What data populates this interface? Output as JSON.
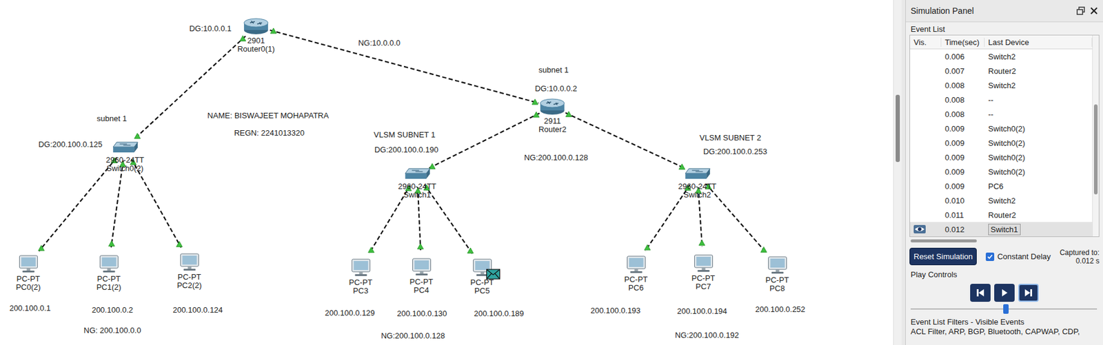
{
  "canvas": {
    "devices": [
      {
        "name": "Router0(1)",
        "model": "2901",
        "kind": "router",
        "packet": false
      },
      {
        "name": "Router2",
        "model": "2911",
        "kind": "router",
        "packet": false
      },
      {
        "name": "Switch0(2)",
        "model": "2960-24TT",
        "kind": "switch",
        "packet": false
      },
      {
        "name": "Switch1",
        "model": "2960-24TT",
        "kind": "switch",
        "packet": false
      },
      {
        "name": "Switch2",
        "model": "2960-24TT",
        "kind": "switch",
        "packet": false
      },
      {
        "name": "PC0(2)",
        "model": "PC-PT",
        "kind": "pc",
        "packet": false
      },
      {
        "name": "PC1(2)",
        "model": "PC-PT",
        "kind": "pc",
        "packet": false
      },
      {
        "name": "PC2(2)",
        "model": "PC-PT",
        "kind": "pc",
        "packet": false
      },
      {
        "name": "PC3",
        "model": "PC-PT",
        "kind": "pc",
        "packet": false
      },
      {
        "name": "PC4",
        "model": "PC-PT",
        "kind": "pc",
        "packet": false
      },
      {
        "name": "PC5",
        "model": "PC-PT",
        "kind": "pc",
        "packet": true
      },
      {
        "name": "PC6",
        "model": "PC-PT",
        "kind": "pc",
        "packet": false
      },
      {
        "name": "PC7",
        "model": "PC-PT",
        "kind": "pc",
        "packet": false
      },
      {
        "name": "PC8",
        "model": "PC-PT",
        "kind": "pc",
        "packet": false
      }
    ],
    "links": [
      {
        "from": "Router0(1)",
        "to": "Switch0(2)"
      },
      {
        "from": "Router0(1)",
        "to": "Router2"
      },
      {
        "from": "Router2",
        "to": "Switch1"
      },
      {
        "from": "Router2",
        "to": "Switch2"
      },
      {
        "from": "Switch0(2)",
        "to": "PC0(2)"
      },
      {
        "from": "Switch0(2)",
        "to": "PC1(2)"
      },
      {
        "from": "Switch0(2)",
        "to": "PC2(2)"
      },
      {
        "from": "Switch1",
        "to": "PC3"
      },
      {
        "from": "Switch1",
        "to": "PC4"
      },
      {
        "from": "Switch1",
        "to": "PC5"
      },
      {
        "from": "Switch2",
        "to": "PC6"
      },
      {
        "from": "Switch2",
        "to": "PC7"
      },
      {
        "from": "Switch2",
        "to": "PC8"
      }
    ],
    "annotations": [
      {
        "text": "DG:10.0.0.1"
      },
      {
        "text": "NG:10.0.0.0"
      },
      {
        "text": "subnet 1"
      },
      {
        "text": "DG:10.0.0.2"
      },
      {
        "text": "subnet 1"
      },
      {
        "text": "NAME: BISWAJEET MOHAPATRA"
      },
      {
        "text": "REGN: 2241013320"
      },
      {
        "text": "DG:200.100.0.125"
      },
      {
        "text": "VLSM SUBNET 1"
      },
      {
        "text": "DG:200.100.0.190"
      },
      {
        "text": "NG:200.100.0.128"
      },
      {
        "text": "VLSM SUBNET 2"
      },
      {
        "text": "DG:200.100.0.253"
      },
      {
        "text": "200.100.0.1"
      },
      {
        "text": "200.100.0.2"
      },
      {
        "text": "200.100.0.124"
      },
      {
        "text": "NG: 200.100.0.0"
      },
      {
        "text": "200.100.0.129"
      },
      {
        "text": "200.100.0.130"
      },
      {
        "text": "200.100.0.189"
      },
      {
        "text": "NG:200.100.0.128"
      },
      {
        "text": "200.100.0.193"
      },
      {
        "text": "200.100.0.194"
      },
      {
        "text": "200.100.0.252"
      },
      {
        "text": "NG:200.100.0.192"
      }
    ]
  },
  "simulation_panel": {
    "title": "Simulation Panel",
    "event_list": {
      "label": "Event List",
      "columns": [
        "Vis.",
        "Time(sec)",
        "Last Device"
      ],
      "rows": [
        {
          "time": "0.006",
          "last_device": "Switch2",
          "visible": false,
          "selected": false
        },
        {
          "time": "0.007",
          "last_device": "Router2",
          "visible": false,
          "selected": false
        },
        {
          "time": "0.008",
          "last_device": "Switch2",
          "visible": false,
          "selected": false
        },
        {
          "time": "0.008",
          "last_device": "--",
          "visible": false,
          "selected": false
        },
        {
          "time": "0.008",
          "last_device": "--",
          "visible": false,
          "selected": false
        },
        {
          "time": "0.009",
          "last_device": "Switch0(2)",
          "visible": false,
          "selected": false
        },
        {
          "time": "0.009",
          "last_device": "Switch0(2)",
          "visible": false,
          "selected": false
        },
        {
          "time": "0.009",
          "last_device": "Switch0(2)",
          "visible": false,
          "selected": false
        },
        {
          "time": "0.009",
          "last_device": "Switch0(2)",
          "visible": false,
          "selected": false
        },
        {
          "time": "0.009",
          "last_device": "PC6",
          "visible": false,
          "selected": false
        },
        {
          "time": "0.010",
          "last_device": "Switch2",
          "visible": false,
          "selected": false
        },
        {
          "time": "0.011",
          "last_device": "Router2",
          "visible": false,
          "selected": false
        },
        {
          "time": "0.012",
          "last_device": "Switch1",
          "visible": true,
          "selected": true
        }
      ]
    },
    "reset_button": "Reset Simulation",
    "constant_delay": {
      "label": "Constant Delay",
      "checked": true
    },
    "captured": {
      "label": "Captured to:",
      "value": "0.012 s"
    },
    "play_controls": {
      "label": "Play Controls",
      "level": 0.51
    },
    "filters": {
      "label": "Event List Filters - Visible Events",
      "value": "ACL Filter, ARP, BGP, Bluetooth, CAPWAP, CDP,"
    }
  }
}
